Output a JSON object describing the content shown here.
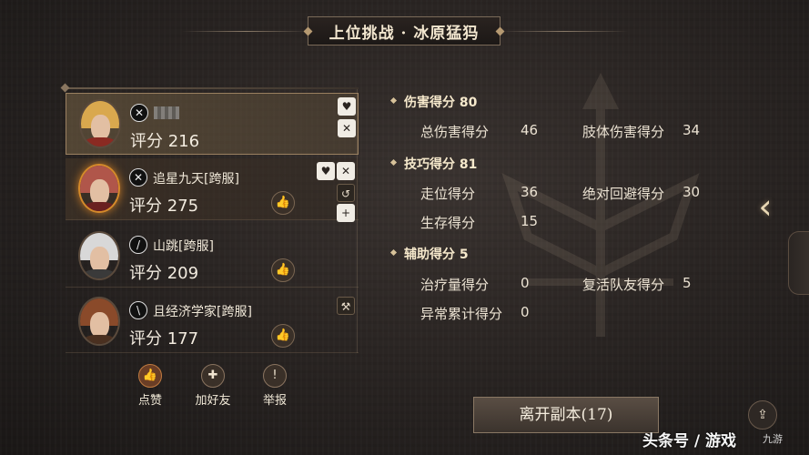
{
  "title": "上位挑战 · 冰原猛犸",
  "players": [
    {
      "name": "",
      "score_label": "评分 216",
      "class_icon": "crossed-swords-icon",
      "self": true
    },
    {
      "name": "追星九天[跨服]",
      "score_label": "评分 275",
      "class_icon": "crossed-swords-icon"
    },
    {
      "name": "山跳[跨服]",
      "score_label": "评分 209",
      "class_icon": "blade-icon"
    },
    {
      "name": "且经济学家[跨服]",
      "score_label": "评分 177",
      "class_icon": "quill-icon"
    }
  ],
  "actions": {
    "like": "点赞",
    "add_friend": "加好友",
    "report": "举报"
  },
  "stats": {
    "damage": {
      "header": "伤害得分 80",
      "total_label": "总伤害得分",
      "total_value": "46",
      "limb_label": "肢体伤害得分",
      "limb_value": "34"
    },
    "skill": {
      "header": "技巧得分 81",
      "move_label": "走位得分",
      "move_value": "36",
      "dodge_label": "绝对回避得分",
      "dodge_value": "30",
      "survive_label": "生存得分",
      "survive_value": "15"
    },
    "support": {
      "header": "辅助得分 5",
      "heal_label": "治疗量得分",
      "heal_value": "0",
      "revive_label": "复活队友得分",
      "revive_value": "5",
      "abnormal_label": "异常累计得分",
      "abnormal_value": "0"
    }
  },
  "exit_button": "离开副本(17)",
  "watermark": "头条号 / 游戏",
  "watermark_small": "九游",
  "colors": {
    "accent": "#d58a2a",
    "panel": "#2a2523"
  }
}
